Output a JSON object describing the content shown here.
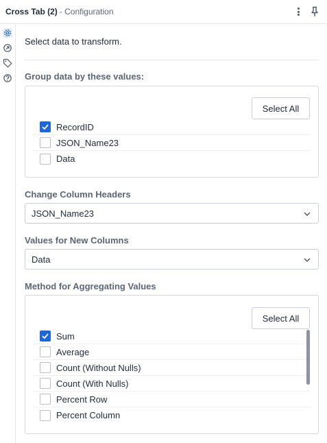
{
  "header": {
    "title": "Cross Tab (2)",
    "subtitle": "- Configuration",
    "more_icon": "kebab-vertical-icon",
    "pin_icon": "pin-icon"
  },
  "rail": {
    "items": [
      {
        "icon": "gear-icon",
        "active": true
      },
      {
        "icon": "arrow-circle-icon",
        "active": false
      },
      {
        "icon": "tag-icon",
        "active": false
      },
      {
        "icon": "help-circle-icon",
        "active": false
      }
    ]
  },
  "intro": "Select data to transform.",
  "group_section": {
    "label": "Group data by these values:",
    "select_all_label": "Select All",
    "items": [
      {
        "label": "RecordID",
        "checked": true
      },
      {
        "label": "JSON_Name23",
        "checked": false
      },
      {
        "label": "Data",
        "checked": false
      }
    ]
  },
  "headers_section": {
    "label": "Change Column Headers",
    "value": "JSON_Name23"
  },
  "values_section": {
    "label": "Values for New Columns",
    "value": "Data"
  },
  "method_section": {
    "label": "Method for Aggregating Values",
    "select_all_label": "Select All",
    "items": [
      {
        "label": "Sum",
        "checked": true
      },
      {
        "label": "Average",
        "checked": false
      },
      {
        "label": "Count (Without Nulls)",
        "checked": false
      },
      {
        "label": "Count (With Nulls)",
        "checked": false
      },
      {
        "label": "Percent Row",
        "checked": false
      },
      {
        "label": "Percent Column",
        "checked": false
      }
    ]
  },
  "colors": {
    "accent": "#1f66d6",
    "label_gray": "#5b6675",
    "border": "#d3d8df"
  }
}
